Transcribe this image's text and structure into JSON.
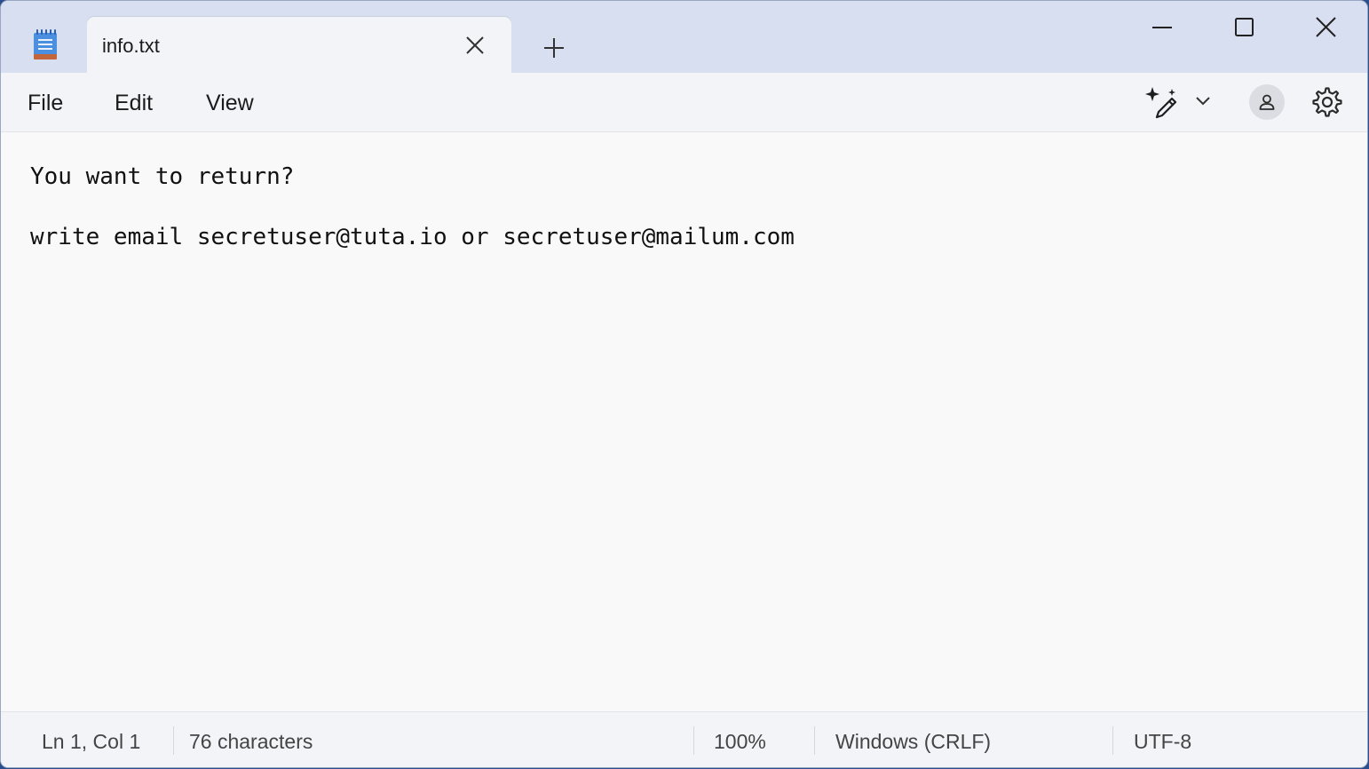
{
  "window": {
    "tab_title": "info.txt"
  },
  "icons": {
    "app": "notepad-icon",
    "tab_close": "close-icon",
    "new_tab": "plus-icon",
    "minimize": "minimize-icon",
    "maximize": "maximize-icon",
    "close": "close-icon",
    "copilot": "copilot-sparkle-pen-icon",
    "copilot_menu": "chevron-down-icon",
    "account": "account-icon",
    "settings": "gear-icon"
  },
  "menu": {
    "file": "File",
    "edit": "Edit",
    "view": "View"
  },
  "editor": {
    "lines": [
      "You want to return?",
      "",
      "write email secretuser@tuta.io or secretuser@mailum.com"
    ]
  },
  "status": {
    "position": "Ln 1, Col 1",
    "characters": "76 characters",
    "zoom": "100%",
    "line_ending": "Windows (CRLF)",
    "encoding": "UTF-8"
  },
  "colors": {
    "titlebar": "#d8dff0",
    "editor_bg": "#f9f9f9",
    "icon_blue": "#3b7dd8"
  }
}
